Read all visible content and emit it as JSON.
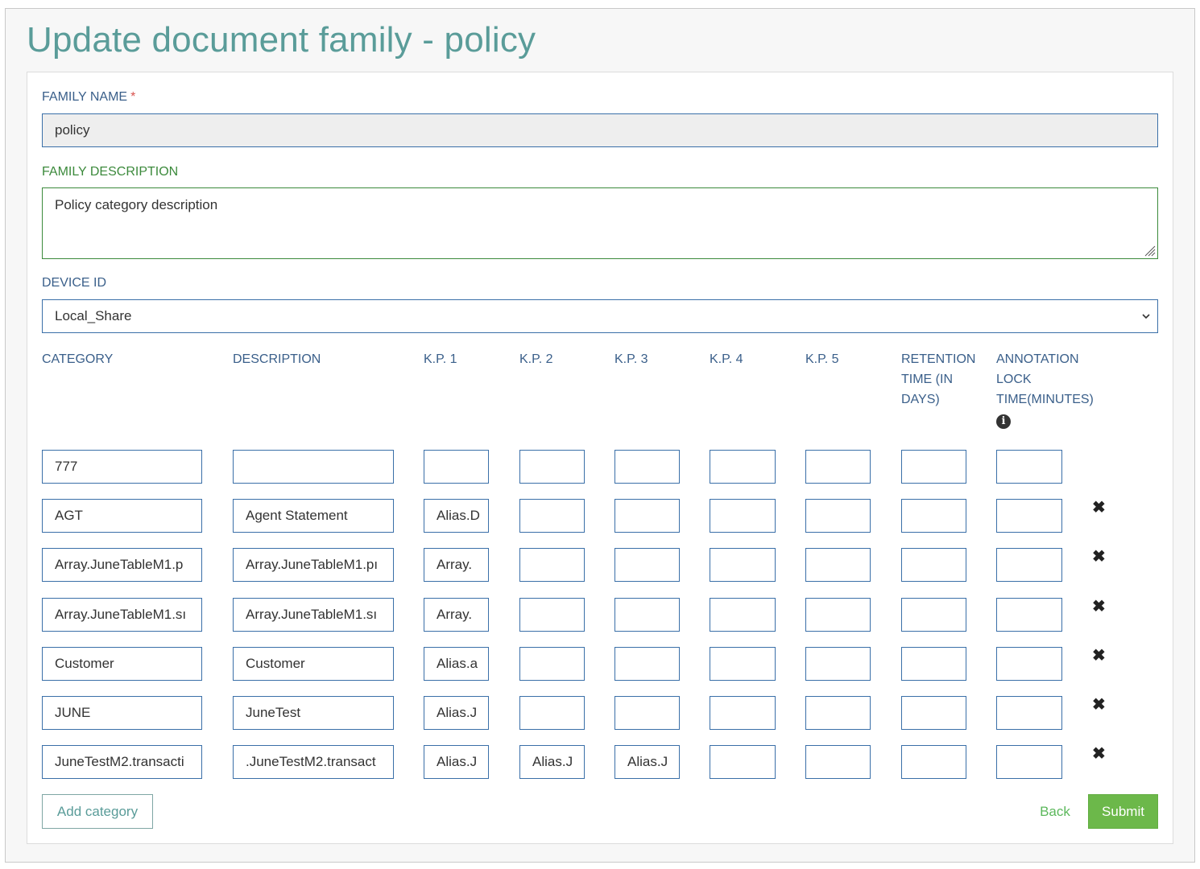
{
  "page": {
    "title": "Update document family - policy"
  },
  "form": {
    "family_name": {
      "label": "FAMILY NAME",
      "required_mark": "*",
      "value": "policy"
    },
    "family_description": {
      "label": "FAMILY DESCRIPTION",
      "value": "Policy category description"
    },
    "device_id": {
      "label": "DEVICE ID",
      "selected": "Local_Share"
    }
  },
  "table": {
    "headers": {
      "category": "CATEGORY",
      "description": "DESCRIPTION",
      "kp1": "K.P. 1",
      "kp2": "K.P. 2",
      "kp3": "K.P. 3",
      "kp4": "K.P. 4",
      "kp5": "K.P. 5",
      "retention_l1": "RETENTION",
      "retention_l2": "TIME (IN",
      "retention_l3": "DAYS)",
      "annotation_l1": "ANNOTATION",
      "annotation_l2": "LOCK",
      "annotation_l3": "TIME(MINUTES)",
      "info_icon": "info-circle-icon"
    },
    "rows": [
      {
        "category": "777",
        "description": "",
        "kp1": "",
        "kp2": "",
        "kp3": "",
        "kp4": "",
        "kp5": "",
        "retention": "",
        "annotation": "",
        "deletable": false
      },
      {
        "category": "AGT",
        "description": "Agent Statement",
        "kp1": "Alias.D",
        "kp2": "",
        "kp3": "",
        "kp4": "",
        "kp5": "",
        "retention": "",
        "annotation": "",
        "deletable": true
      },
      {
        "category": "Array.JuneTableM1.p",
        "description": "Array.JuneTableM1.pı",
        "kp1": "Array.",
        "kp2": "",
        "kp3": "",
        "kp4": "",
        "kp5": "",
        "retention": "",
        "annotation": "",
        "deletable": true
      },
      {
        "category": "Array.JuneTableM1.sı",
        "description": "Array.JuneTableM1.sı",
        "kp1": "Array.",
        "kp2": "",
        "kp3": "",
        "kp4": "",
        "kp5": "",
        "retention": "",
        "annotation": "",
        "deletable": true
      },
      {
        "category": "Customer",
        "description": "Customer",
        "kp1": "Alias.a",
        "kp2": "",
        "kp3": "",
        "kp4": "",
        "kp5": "",
        "retention": "",
        "annotation": "",
        "deletable": true
      },
      {
        "category": "JUNE",
        "description": "JuneTest",
        "kp1": "Alias.J",
        "kp2": "",
        "kp3": "",
        "kp4": "",
        "kp5": "",
        "retention": "",
        "annotation": "",
        "deletable": true
      },
      {
        "category": "JuneTestM2.transacti",
        "description": ".JuneTestM2.transact",
        "kp1": "Alias.J",
        "kp2": "Alias.J",
        "kp3": "Alias.J",
        "kp4": "",
        "kp5": "",
        "retention": "",
        "annotation": "",
        "deletable": true
      }
    ],
    "delete_icon": "close-x-icon",
    "delete_glyph": "✖"
  },
  "actions": {
    "add_category": "Add category",
    "back": "Back",
    "submit": "Submit"
  },
  "colors": {
    "title": "#5a9c99",
    "label": "#3a5f8a",
    "label_active": "#3c8a3c",
    "input_border": "#3a6fa8",
    "submit_bg": "#6cb84a",
    "back_text": "#5cb85c"
  }
}
